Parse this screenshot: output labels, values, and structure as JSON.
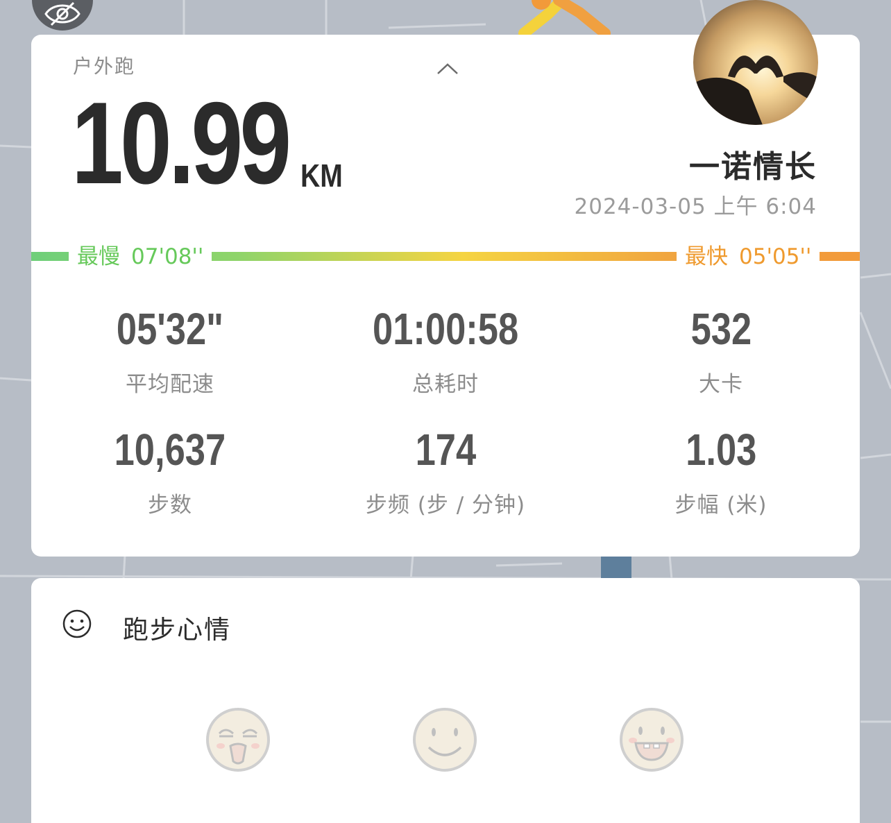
{
  "activity": {
    "sport_type": "户外跑",
    "distance": "10.99",
    "distance_unit": "KM"
  },
  "user": {
    "name": "一诺情长",
    "datetime": "2024-03-05 上午 6:04"
  },
  "pace": {
    "slowest_label": "最慢",
    "slowest_value": "07'08''",
    "fastest_label": "最快",
    "fastest_value": "05'05''",
    "colors": {
      "slow": "#66c95a",
      "fast": "#ef9a2e"
    }
  },
  "stats": [
    {
      "value": "05'32\"",
      "label": "平均配速"
    },
    {
      "value": "01:00:58",
      "label": "总耗时"
    },
    {
      "value": "532",
      "label": "大卡"
    },
    {
      "value": "10,637",
      "label": "步数"
    },
    {
      "value": "174",
      "label": "步频 (步 / 分钟)"
    },
    {
      "value": "1.03",
      "label": "步幅 (米)"
    }
  ],
  "mood": {
    "title": "跑步心情",
    "options": [
      "exhausted-face-icon",
      "smile-face-icon",
      "grin-face-icon"
    ]
  },
  "icons": {
    "privacy": "eye-slash-icon",
    "collapse": "chevron-up-icon",
    "mood_header": "smiley-icon"
  }
}
